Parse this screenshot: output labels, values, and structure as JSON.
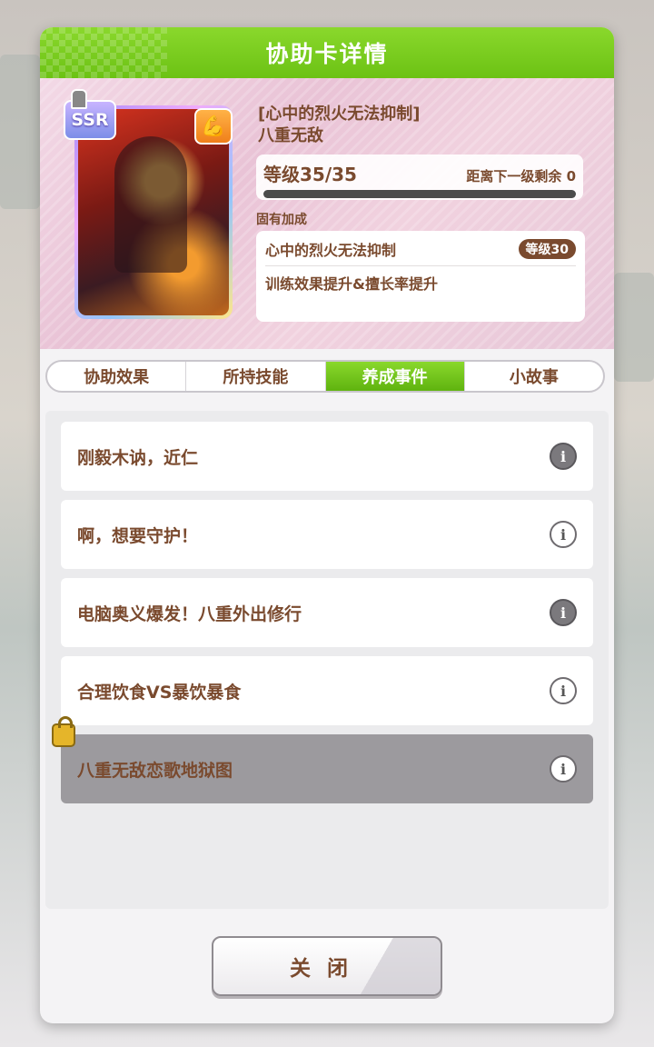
{
  "dialog": {
    "title": "协助卡详情"
  },
  "card": {
    "rarity": "SSR",
    "type_icon": "power-icon",
    "epithet": "[心中的烈火无法抑制]",
    "name": "八重无敌",
    "level_text": "等级35/35",
    "next_level_text": "距离下一级剩余",
    "next_level_value": "0",
    "level_progress": 1.0
  },
  "bonus": {
    "label": "固有加成",
    "name": "心中的烈火无法抑制",
    "level": "等级30",
    "description": "训练效果提升&擅长率提升"
  },
  "tabs": [
    {
      "label": "协助效果",
      "active": false
    },
    {
      "label": "所持技能",
      "active": false
    },
    {
      "label": "养成事件",
      "active": true
    },
    {
      "label": "小故事",
      "active": false
    }
  ],
  "events": [
    {
      "title": "刚毅木讷，近仁",
      "locked": false
    },
    {
      "title": "啊，想要守护！",
      "locked": false
    },
    {
      "title": "电脑奥义爆发！八重外出修行",
      "locked": false
    },
    {
      "title": "合理饮食VS暴饮暴食",
      "locked": false
    },
    {
      "title": "八重无敌恋歌地狱图",
      "locked": true
    }
  ],
  "info_glyph": "i",
  "close_label": "关闭",
  "colors": {
    "accent_green": "#6cc214",
    "text_brown": "#7a4a2e"
  }
}
